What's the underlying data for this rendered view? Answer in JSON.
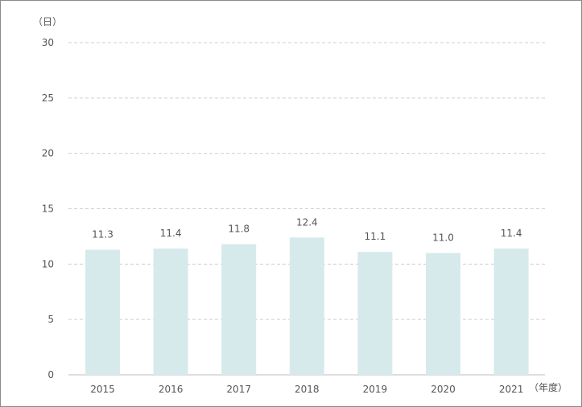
{
  "chart_data": {
    "type": "bar",
    "y_unit": "（日）",
    "x_unit": "（年度）",
    "categories": [
      "2015",
      "2016",
      "2017",
      "2018",
      "2019",
      "2020",
      "2021"
    ],
    "values": [
      11.3,
      11.4,
      11.8,
      12.4,
      11.1,
      11.0,
      11.4
    ],
    "value_labels": [
      "11.3",
      "11.4",
      "11.8",
      "12.4",
      "11.1",
      "11.0",
      "11.4"
    ],
    "ylim": [
      0,
      30
    ],
    "yticks": [
      "0",
      "5",
      "10",
      "15",
      "20",
      "25",
      "30"
    ],
    "grid": true,
    "bar_color": "#d6eaeb"
  }
}
